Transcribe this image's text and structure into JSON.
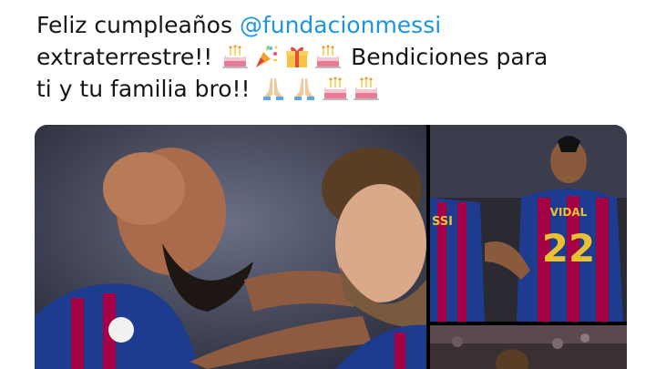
{
  "tweet": {
    "line1_text": "Feliz cumpleaños ",
    "mention": "@fundacionmessi",
    "line2_text": "extraterrestre!!",
    "line2_after": " Bendiciones para",
    "line3_text": "ti y tu familia bro!!"
  },
  "emojis": {
    "line2": [
      "birthday-cake-icon",
      "party-popper-icon",
      "wrapped-gift-icon",
      "birthday-cake-icon"
    ],
    "line3": [
      "folded-hands-icon",
      "folded-hands-icon",
      "birthday-cake-icon",
      "birthday-cake-icon"
    ]
  },
  "photos": {
    "right_top_jersey_name": "VIDAL",
    "right_top_jersey_number": "22",
    "right_top_left_jersey_partial": "SSI"
  },
  "colors": {
    "mention": "#1b95e0",
    "text": "#14171a",
    "barca_blue": "#1d3b8f",
    "barca_red": "#a50044",
    "gold": "#e8c233"
  }
}
